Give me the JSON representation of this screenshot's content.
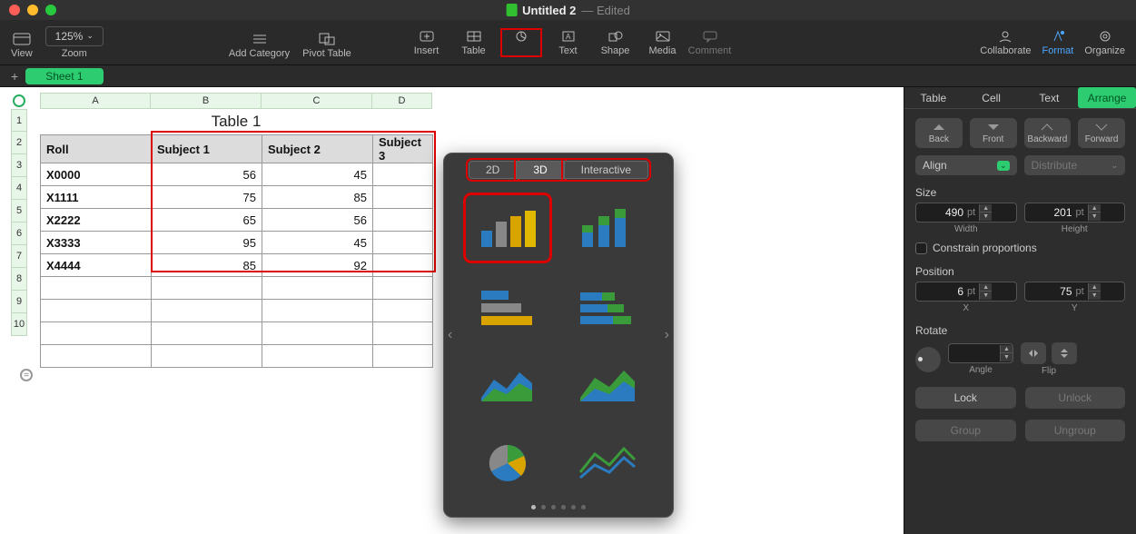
{
  "window": {
    "title": "Untitled 2",
    "edited": "— Edited"
  },
  "toolbar": {
    "view": "View",
    "zoom": "Zoom",
    "zoom_value": "125%",
    "add_category": "Add Category",
    "pivot": "Pivot Table",
    "insert": "Insert",
    "table": "Table",
    "chart": "Chart",
    "text": "Text",
    "shape": "Shape",
    "media": "Media",
    "comment": "Comment",
    "collaborate": "Collaborate",
    "format": "Format",
    "organize": "Organize"
  },
  "sheet_tab": "Sheet 1",
  "columns": [
    "A",
    "B",
    "C",
    "D"
  ],
  "row_numbers": [
    "1",
    "2",
    "3",
    "4",
    "5",
    "6",
    "7",
    "8",
    "9",
    "10"
  ],
  "table": {
    "title": "Table 1",
    "headers": {
      "roll": "Roll",
      "s1": "Subject 1",
      "s2": "Subject 2",
      "s3": "Subject 3"
    },
    "rows": [
      {
        "roll": "X0000",
        "s1": "56",
        "s2": "45",
        "s3": ""
      },
      {
        "roll": "X1111",
        "s1": "75",
        "s2": "85",
        "s3": ""
      },
      {
        "roll": "X2222",
        "s1": "65",
        "s2": "56",
        "s3": ""
      },
      {
        "roll": "X3333",
        "s1": "95",
        "s2": "45",
        "s3": ""
      },
      {
        "roll": "X4444",
        "s1": "85",
        "s2": "92",
        "s3": ""
      }
    ]
  },
  "chart_data": {
    "type": "table",
    "title": "Table 1",
    "categories": [
      "X0000",
      "X1111",
      "X2222",
      "X3333",
      "X4444"
    ],
    "series": [
      {
        "name": "Subject 1",
        "values": [
          56,
          75,
          65,
          95,
          85
        ]
      },
      {
        "name": "Subject 2",
        "values": [
          45,
          85,
          56,
          45,
          92
        ]
      }
    ]
  },
  "popover": {
    "tabs": {
      "t2d": "2D",
      "t3d": "3D",
      "interactive": "Interactive"
    }
  },
  "inspector": {
    "tabs": {
      "table": "Table",
      "cell": "Cell",
      "text": "Text",
      "arrange": "Arrange"
    },
    "arrange": {
      "back": "Back",
      "front": "Front",
      "backward": "Backward",
      "forward": "Forward",
      "align": "Align",
      "distribute": "Distribute",
      "size": "Size",
      "width_val": "490",
      "height_val": "201",
      "width": "Width",
      "height": "Height",
      "pt": "pt",
      "constrain": "Constrain proportions",
      "position": "Position",
      "x_val": "6",
      "y_val": "75",
      "x": "X",
      "y": "Y",
      "rotate": "Rotate",
      "angle": "Angle",
      "flip": "Flip",
      "lock": "Lock",
      "unlock": "Unlock",
      "group": "Group",
      "ungroup": "Ungroup"
    }
  }
}
